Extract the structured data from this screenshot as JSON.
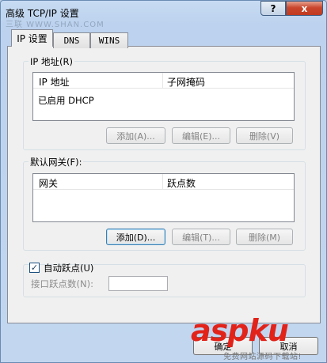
{
  "window": {
    "title": "高级 TCP/IP 设置",
    "help_glyph": "?",
    "close_glyph": "x",
    "faint_overlay_text": "三联 WWW.SHAN.COM"
  },
  "tabs": [
    {
      "label": "IP 设置",
      "active": true
    },
    {
      "label": "DNS",
      "active": false
    },
    {
      "label": "WINS",
      "active": false
    }
  ],
  "ip_group": {
    "title": "IP 地址(R)",
    "columns": [
      "IP 地址",
      "子网掩码"
    ],
    "rows": [
      "已启用 DHCP"
    ],
    "buttons": {
      "add": "添加(A)...",
      "edit": "编辑(E)...",
      "delete": "删除(V)"
    }
  },
  "gateway_group": {
    "title": "默认网关(F):",
    "columns": [
      "网关",
      "跃点数"
    ],
    "rows": [],
    "buttons": {
      "add": "添加(D)...",
      "edit": "编辑(T)...",
      "delete": "删除(M)"
    }
  },
  "auto_metric": {
    "checkbox_label": "自动跃点(U)",
    "checked": true,
    "check_glyph": "✓",
    "interface_metric_label": "接口跃点数(N):",
    "interface_metric_value": ""
  },
  "footer_buttons": {
    "ok": "确定",
    "cancel": "取消"
  },
  "watermark": {
    "brand": "aspku",
    "tagline": "免费网站源码下载站!"
  },
  "colors": {
    "titlebar": "#c7dbf2",
    "close_button": "#c9472d",
    "panel": "#f0f0f0",
    "watermark": "#e2231a"
  }
}
